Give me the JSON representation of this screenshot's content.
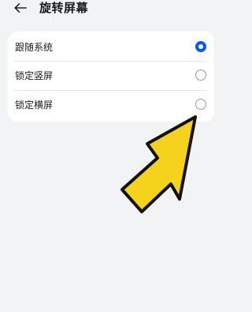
{
  "header": {
    "title": "旋转屏幕",
    "back_icon": "arrow-left-icon"
  },
  "options": [
    {
      "label": "跟随系统",
      "selected": true
    },
    {
      "label": "锁定竖屏",
      "selected": false
    },
    {
      "label": "锁定横屏",
      "selected": false
    }
  ],
  "colors": {
    "accent": "#0a59f7",
    "background": "#f1f3f5",
    "card": "#ffffff",
    "annotation_arrow_fill": "#f5d21c",
    "annotation_arrow_stroke": "#111111"
  }
}
